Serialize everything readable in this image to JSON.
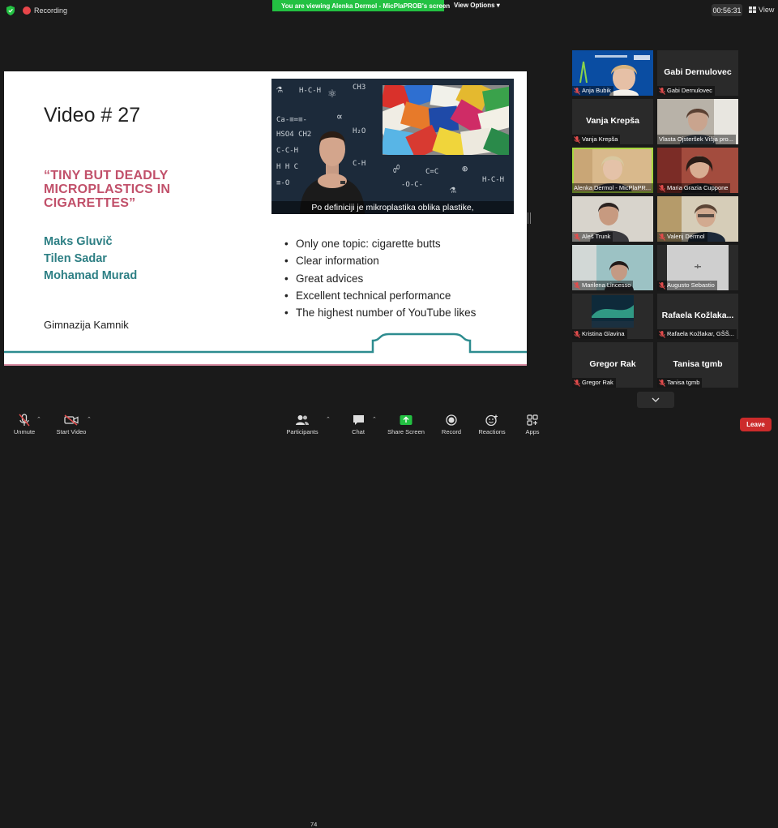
{
  "topbar": {
    "recording_label": "Recording",
    "viewing_text": "You are viewing Alenka Dermol - MicPlaPROB's screen",
    "view_options_label": "View Options",
    "timer": "00:56:31",
    "view_label": "View"
  },
  "slide": {
    "title": "Video # 27",
    "quote": "“TINY BUT DEADLY MICROPLASTICS IN CIGARETTES”",
    "authors": [
      "Maks Gluvič",
      "Tilen Sadar",
      "Mohamad Murad"
    ],
    "school": "Gimnazija Kamnik",
    "video_caption": "Po definiciji je mikroplastika oblika plastike,",
    "bullets": [
      "Only one topic: cigarette butts",
      "Clear information",
      "Great advices",
      "Excellent technical performance",
      "The highest number of YouTube likes"
    ]
  },
  "participants": [
    {
      "label": "Anja Bubik",
      "big_name": "",
      "kind": "video-1"
    },
    {
      "label": "Gabi Dernulovec",
      "big_name": "Gabi Dernulovec",
      "kind": "name"
    },
    {
      "label": "Vanja Krepša",
      "big_name": "Vanja Krepša",
      "kind": "name"
    },
    {
      "label": "Vlasta Ojsteršek Višja pro...",
      "big_name": "",
      "kind": "video-2"
    },
    {
      "label": "Alenka Dermol - MicPlaPR...",
      "big_name": "",
      "kind": "video-3"
    },
    {
      "label": "Maria Grazia Cuppone",
      "big_name": "",
      "kind": "video-4"
    },
    {
      "label": "Aleš Trunk",
      "big_name": "",
      "kind": "video-5"
    },
    {
      "label": "Valerij Dermol",
      "big_name": "",
      "kind": "video-6"
    },
    {
      "label": "Marilena Lincesso",
      "big_name": "",
      "kind": "video-7"
    },
    {
      "label": "Augusto Sebastio",
      "big_name": "",
      "kind": "video-8"
    },
    {
      "label": "Kristina Glavina",
      "big_name": "",
      "kind": "video-9"
    },
    {
      "label": "Rafaela  Kožlakar, GŠŠ...",
      "big_name": "Rafaela  Kožlaka...",
      "kind": "name"
    },
    {
      "label": "Gregor Rak",
      "big_name": "Gregor Rak",
      "kind": "name"
    },
    {
      "label": "Tanisa tgmb",
      "big_name": "Tanisa tgmb",
      "kind": "name"
    }
  ],
  "toolbar": {
    "unmute": "Unmute",
    "start_video": "Start Video",
    "participants": "Participants",
    "participants_count": "74",
    "chat": "Chat",
    "share_screen": "Share Screen",
    "record": "Record",
    "reactions": "Reactions",
    "apps": "Apps",
    "leave": "Leave"
  },
  "colors": {
    "share_green": "#23c142",
    "quote": "#c1506a",
    "authors": "#2d7f84",
    "leave": "#cc2b2b",
    "speaking_outline": "#a8d83f"
  }
}
